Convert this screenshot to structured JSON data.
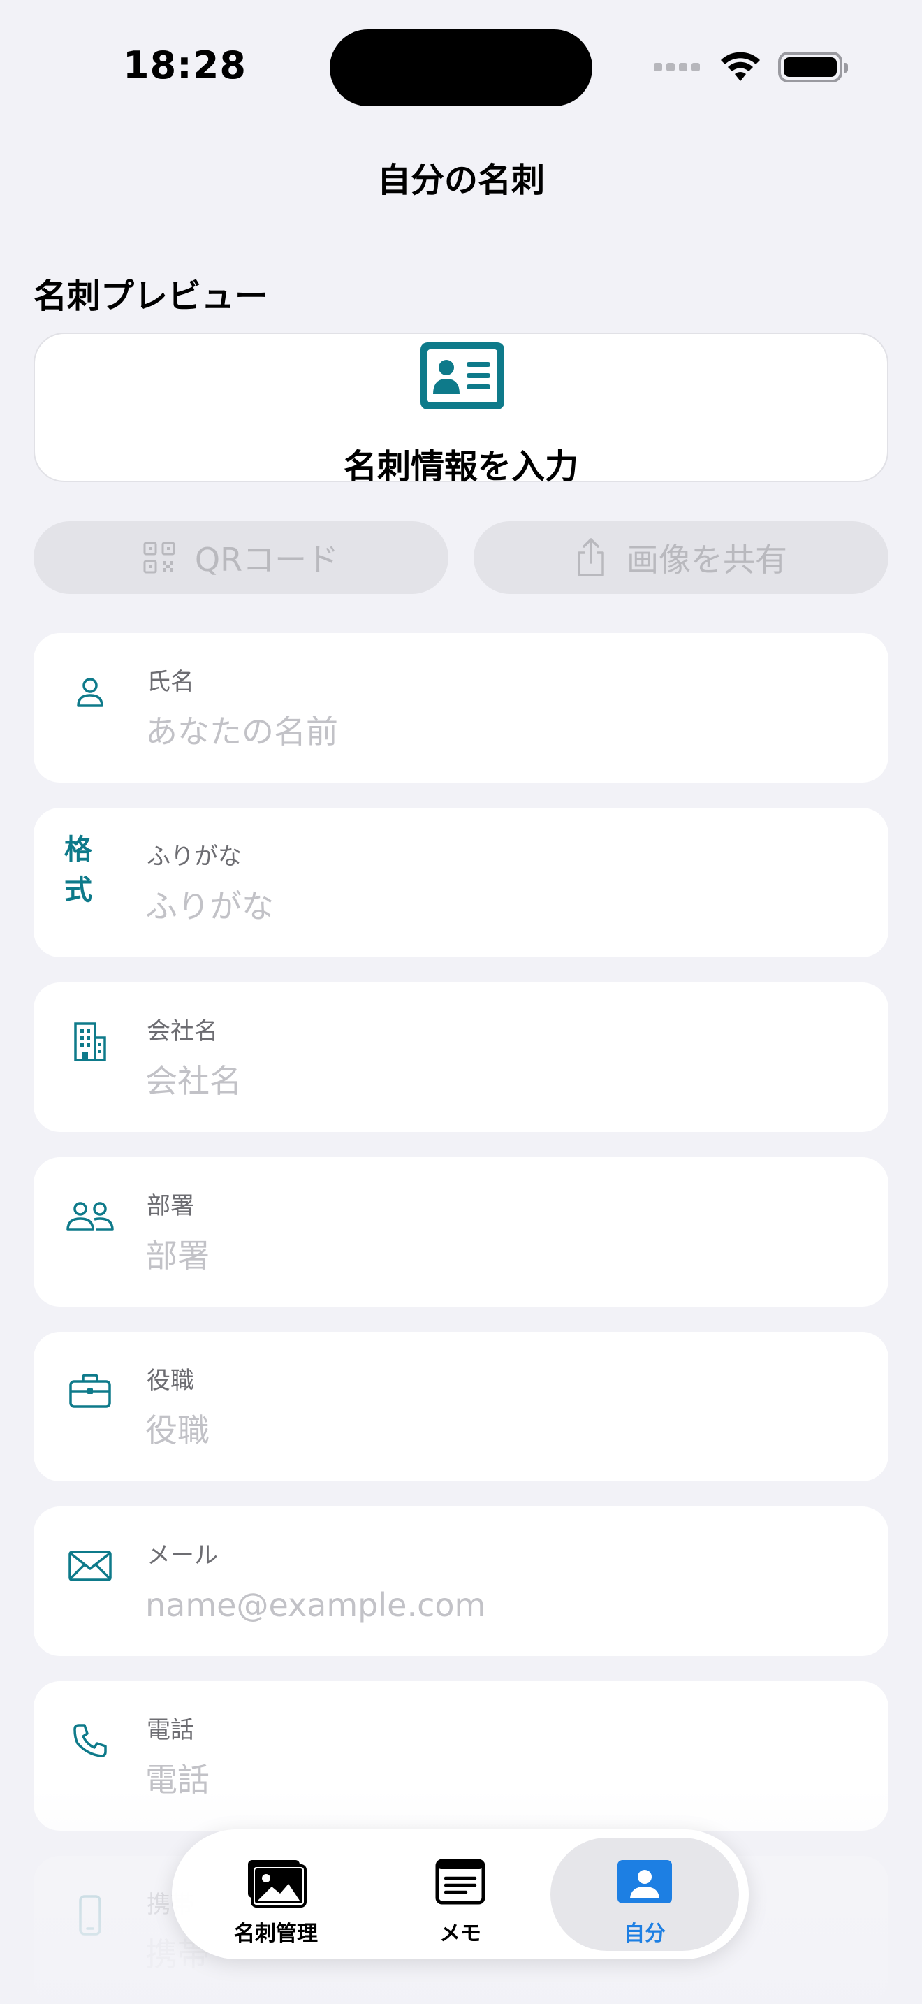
{
  "status_bar": {
    "time": "18:28"
  },
  "header": {
    "title": "自分の名刺"
  },
  "preview": {
    "section_title": "名刺プレビュー",
    "placeholder_text": "名刺情報を入力"
  },
  "actions": {
    "qr_label": "QRコード",
    "share_label": "画像を共有"
  },
  "fields": [
    {
      "label": "氏名",
      "placeholder": "あなたの名前",
      "icon": "person-icon"
    },
    {
      "label": "ふりがな",
      "placeholder": "ふりがな",
      "icon_text": "格式"
    },
    {
      "label": "会社名",
      "placeholder": "会社名",
      "icon": "building-icon"
    },
    {
      "label": "部署",
      "placeholder": "部署",
      "icon": "people-icon"
    },
    {
      "label": "役職",
      "placeholder": "役職",
      "icon": "briefcase-icon"
    },
    {
      "label": "メール",
      "placeholder": "name@example.com",
      "icon": "envelope-icon"
    },
    {
      "label": "電話",
      "placeholder": "電話",
      "icon": "phone-icon"
    },
    {
      "label": "携帯",
      "placeholder": "携帯",
      "icon": "mobile-icon"
    }
  ],
  "tabbar": {
    "tabs": [
      {
        "label": "名刺管理",
        "icon": "photo-stack-icon"
      },
      {
        "label": "メモ",
        "icon": "memo-icon"
      },
      {
        "label": "自分",
        "icon": "person-card-icon"
      }
    ]
  },
  "colors": {
    "accent": "#0e7a8a",
    "tab_active": "#1d7fe3",
    "background": "#f2f2f7"
  }
}
